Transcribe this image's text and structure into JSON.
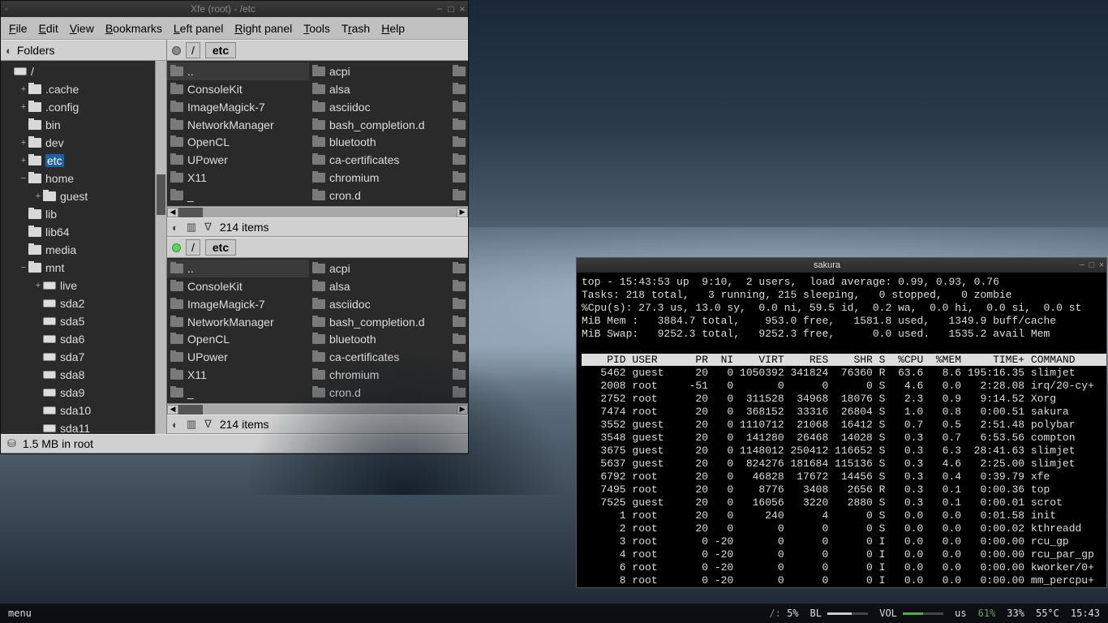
{
  "xfe": {
    "title": "Xfe (root) - /etc",
    "menus": [
      "File",
      "Edit",
      "View",
      "Bookmarks",
      "Left panel",
      "Right panel",
      "Tools",
      "Trash",
      "Help"
    ],
    "folders_label": "Folders",
    "tree": [
      {
        "depth": 0,
        "expander": "",
        "icon": "drive",
        "label": "/",
        "sel": false
      },
      {
        "depth": 1,
        "expander": "+",
        "icon": "folder",
        "label": ".cache"
      },
      {
        "depth": 1,
        "expander": "+",
        "icon": "folder",
        "label": ".config"
      },
      {
        "depth": 1,
        "expander": "",
        "icon": "folder",
        "label": "bin"
      },
      {
        "depth": 1,
        "expander": "+",
        "icon": "folder",
        "label": "dev"
      },
      {
        "depth": 1,
        "expander": "+",
        "icon": "folder",
        "label": "etc",
        "sel": true
      },
      {
        "depth": 1,
        "expander": "−",
        "icon": "folder",
        "label": "home"
      },
      {
        "depth": 2,
        "expander": "+",
        "icon": "folder",
        "label": "guest"
      },
      {
        "depth": 1,
        "expander": "",
        "icon": "folder",
        "label": "lib"
      },
      {
        "depth": 1,
        "expander": "",
        "icon": "folder",
        "label": "lib64"
      },
      {
        "depth": 1,
        "expander": "",
        "icon": "folder",
        "label": "media"
      },
      {
        "depth": 1,
        "expander": "−",
        "icon": "folder",
        "label": "mnt"
      },
      {
        "depth": 2,
        "expander": "+",
        "icon": "drive",
        "label": "live"
      },
      {
        "depth": 2,
        "expander": "",
        "icon": "drive",
        "label": "sda2"
      },
      {
        "depth": 2,
        "expander": "",
        "icon": "drive",
        "label": "sda5"
      },
      {
        "depth": 2,
        "expander": "",
        "icon": "drive",
        "label": "sda6"
      },
      {
        "depth": 2,
        "expander": "",
        "icon": "drive",
        "label": "sda7"
      },
      {
        "depth": 2,
        "expander": "",
        "icon": "drive",
        "label": "sda8"
      },
      {
        "depth": 2,
        "expander": "",
        "icon": "drive",
        "label": "sda9"
      },
      {
        "depth": 2,
        "expander": "",
        "icon": "drive",
        "label": "sda10"
      },
      {
        "depth": 2,
        "expander": "",
        "icon": "drive",
        "label": "sda11"
      }
    ],
    "panel": {
      "crumbs": [
        "/",
        "etc"
      ],
      "col1": [
        "..",
        "ConsoleKit",
        "ImageMagick-7",
        "NetworkManager",
        "OpenCL",
        "UPower",
        "X11",
        "_"
      ],
      "col2": [
        "acpi",
        "alsa",
        "asciidoc",
        "bash_completion.d",
        "bluetooth",
        "ca-certificates",
        "chromium",
        "cron.d"
      ],
      "status": "214 items"
    },
    "statusbar": "1.5 MB in root"
  },
  "sakura": {
    "title": "sakura",
    "top_header": [
      "top - 15:43:53 up  9:10,  2 users,  load average: 0.99, 0.93, 0.76",
      "Tasks: 218 total,   3 running, 215 sleeping,   0 stopped,   0 zombie",
      "%Cpu(s): 27.3 us, 13.0 sy,  0.0 ni, 59.5 id,  0.2 wa,  0.0 hi,  0.0 si,  0.0 st",
      "MiB Mem :   3884.7 total,    953.0 free,   1581.8 used,   1349.9 buff/cache",
      "MiB Swap:   9252.3 total,   9252.3 free,      0.0 used.   1535.2 avail Mem"
    ],
    "cols": "    PID USER      PR  NI    VIRT    RES    SHR S  %CPU  %MEM     TIME+ COMMAND",
    "rows": [
      "   5462 guest     20   0 1050392 341824  76360 R  63.6   8.6 195:16.35 slimjet",
      "   2008 root     -51   0       0      0      0 S   4.6   0.0   2:28.08 irq/20-cy+",
      "   2752 root      20   0  311528  34968  18076 S   2.3   0.9   9:14.52 Xorg",
      "   7474 root      20   0  368152  33316  26804 S   1.0   0.8   0:00.51 sakura",
      "   3552 guest     20   0 1110712  21068  16412 S   0.7   0.5   2:51.48 polybar",
      "   3548 guest     20   0  141280  26468  14028 S   0.3   0.7   6:53.56 compton",
      "   3675 guest     20   0 1148012 250412 116652 S   0.3   6.3  28:41.63 slimjet",
      "   5637 guest     20   0  824276 181684 115136 S   0.3   4.6   2:25.00 slimjet",
      "   6792 root      20   0   46828  17672  14456 S   0.3   0.4   0:39.79 xfe",
      "   7495 root      20   0    8776   3408   2656 R   0.3   0.1   0:00.36 top",
      "   7525 guest     20   0   16056   3220   2880 S   0.3   0.1   0:00.01 scrot",
      "      1 root      20   0     240      4      0 S   0.0   0.0   0:01.58 init",
      "      2 root      20   0       0      0      0 S   0.0   0.0   0:00.02 kthreadd",
      "      3 root       0 -20       0      0      0 I   0.0   0.0   0:00.00 rcu_gp",
      "      4 root       0 -20       0      0      0 I   0.0   0.0   0:00.00 rcu_par_gp",
      "      6 root       0 -20       0      0      0 I   0.0   0.0   0:00.00 kworker/0+",
      "      8 root       0 -20       0      0      0 I   0.0   0.0   0:00.00 mm_percpu+"
    ]
  },
  "polybar": {
    "menu": "menu",
    "root_label": "/:",
    "root_pct": "5%",
    "bl_label": "BL",
    "vol_label": "VOL",
    "kb": "us",
    "cpu": "61%",
    "mem": "33%",
    "temp": "55°C",
    "time": "15:43"
  }
}
